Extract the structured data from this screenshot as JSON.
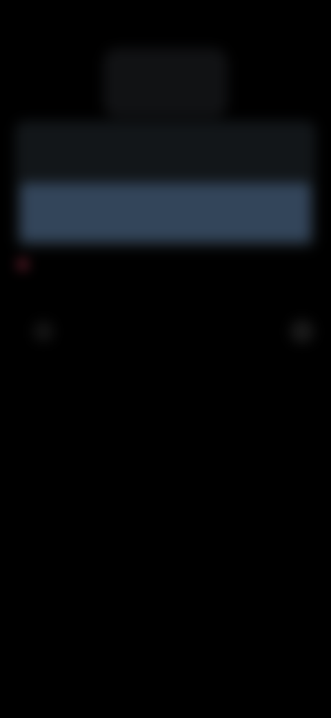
{
  "status_bar": {
    "time": "",
    "icons": ""
  },
  "header": {
    "title": "",
    "action_label": ""
  },
  "card": {
    "label_left": "",
    "label_right": ""
  },
  "summary": {
    "line1": "",
    "line2": ""
  },
  "list": {
    "row": {
      "text": "",
      "meta": ""
    }
  },
  "colors": {
    "background": "#000000",
    "card": "#121619",
    "highlight": "#33455a",
    "accent": "#8a2a3e"
  }
}
